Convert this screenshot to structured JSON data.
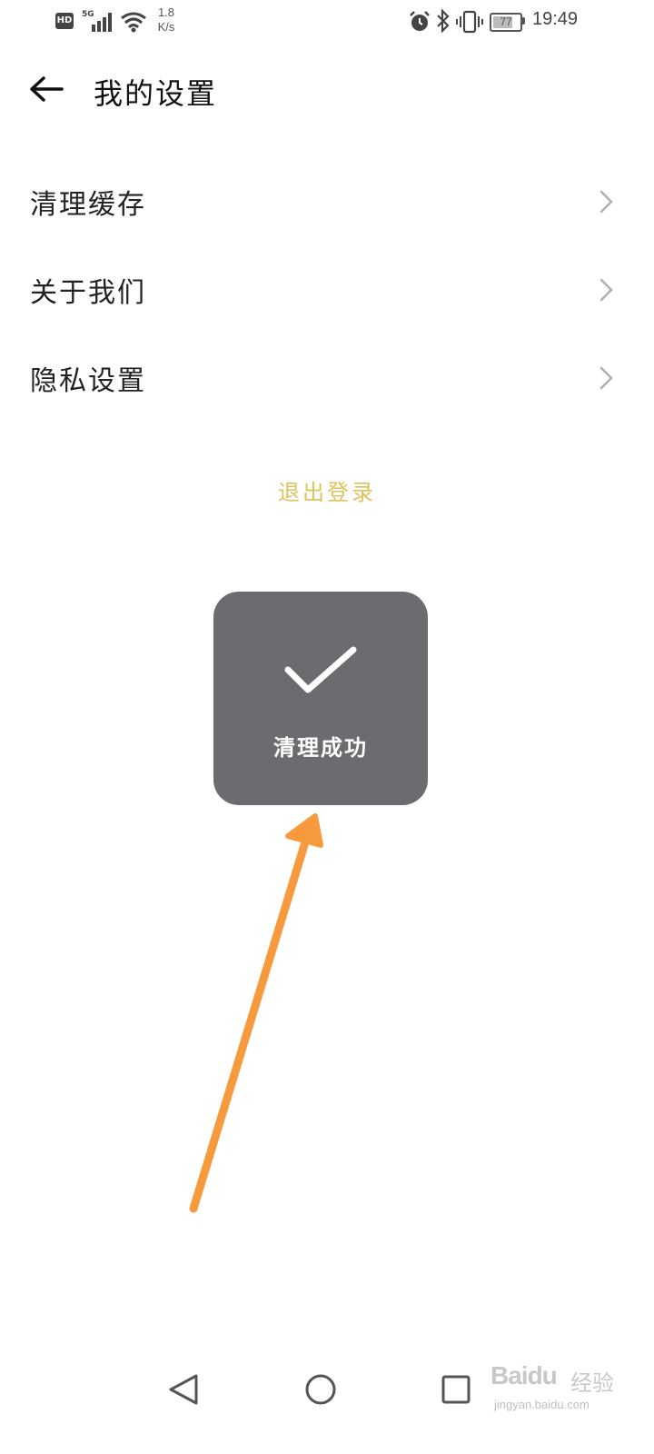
{
  "status_bar": {
    "hd": "HD",
    "network": "5G",
    "speed_value": "1.8",
    "speed_unit": "K/s",
    "battery_level": "77",
    "battery_fraction": 0.77,
    "time": "19:49",
    "icons": [
      "hd-icon",
      "signal-icon",
      "wifi-icon",
      "alarm-icon",
      "bluetooth-icon",
      "vibrate-icon",
      "battery-icon"
    ]
  },
  "header": {
    "title": "我的设置",
    "back_icon": "arrow-left-icon"
  },
  "menu": {
    "items": [
      {
        "label": "清理缓存",
        "icon": "chevron-right-icon"
      },
      {
        "label": "关于我们",
        "icon": "chevron-right-icon"
      },
      {
        "label": "隐私设置",
        "icon": "chevron-right-icon"
      }
    ]
  },
  "logout": {
    "label": "退出登录",
    "color": "#e0c25a"
  },
  "toast": {
    "text": "清理成功",
    "icon": "checkmark-icon",
    "background": "#6b6c70"
  },
  "annotation": {
    "icon": "arrow-up-icon",
    "color": "#f79a3e"
  },
  "nav_bar": {
    "icons": [
      "back-triangle-icon",
      "home-circle-icon",
      "recents-square-icon"
    ]
  },
  "watermark": {
    "brand": "Baidu",
    "brand_cn": "经验",
    "url": "jingyan.baidu.com"
  },
  "colors": {
    "background": "#ffffff",
    "text": "#222222",
    "chevron": "#b0b0b0"
  }
}
